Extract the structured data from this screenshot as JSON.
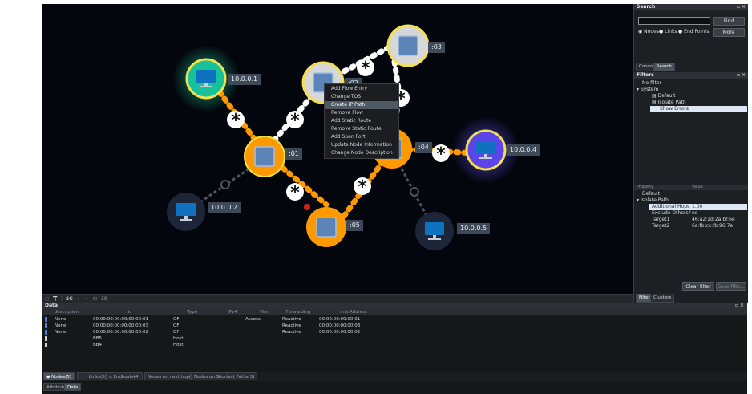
{
  "topology": {
    "nodes": [
      {
        "id": "host-1",
        "label": "10.0.0.1",
        "kind": "host",
        "status": "highlighted"
      },
      {
        "id": "host-2",
        "label": "10.0.0.2",
        "kind": "host"
      },
      {
        "id": "host-4",
        "label": "10.0.0.4",
        "kind": "host",
        "status": "selected"
      },
      {
        "id": "host-5",
        "label": "10.0.0.5",
        "kind": "host"
      },
      {
        "id": "sw-01",
        "label": ":01",
        "kind": "switch"
      },
      {
        "id": "sw-02",
        "label": ":02",
        "kind": "switch"
      },
      {
        "id": "sw-03",
        "label": ":03",
        "kind": "switch"
      },
      {
        "id": "sw-04",
        "label": ":04",
        "kind": "switch"
      },
      {
        "id": "sw-05",
        "label": ":05",
        "kind": "switch"
      }
    ],
    "context_menu": [
      "Add Flow Entry",
      "Change TOS",
      "Create IP Path",
      "Remove Flow",
      "Add Static Route",
      "Remove Static Route",
      "Add Span Port",
      "Update Node Information",
      "Change Node Description"
    ],
    "context_menu_selected": "Create IP Path"
  },
  "toolbar": {
    "t_label": "T",
    "sc_label": "SC",
    "zoom_text": "30"
  },
  "search": {
    "title": "Search",
    "input_value": "",
    "find_label": "Find",
    "options": [
      "Nodes",
      "Links",
      "End Points"
    ],
    "more_label": "More",
    "tabs": [
      "Console",
      "Search"
    ]
  },
  "filters": {
    "title": "Filters",
    "tree": [
      {
        "label": "No filter",
        "level": 0
      },
      {
        "label": "System",
        "level": 0,
        "expanded": true
      },
      {
        "label": "Default",
        "level": 1
      },
      {
        "label": "Isolate Path",
        "level": 1
      },
      {
        "label": "Show Errors",
        "level": 1,
        "selected": true
      }
    ],
    "prop_headers": [
      "Property",
      "Value"
    ],
    "props": [
      {
        "label": "Default",
        "value": "",
        "level": 0
      },
      {
        "label": "Isolate Path",
        "value": "",
        "level": 0,
        "expanded": true
      },
      {
        "label": "Additional Hops",
        "value": "1.00",
        "level": 1,
        "selected": true
      },
      {
        "label": "Exclude Others?",
        "value": "no",
        "level": 1
      },
      {
        "label": "Target1",
        "value": "46:a2:1d:2a:bf:6e",
        "level": 1
      },
      {
        "label": "Target2",
        "value": "6a:fb:cc:fb:96:7e",
        "level": 1
      }
    ],
    "clear_label": "Clear filter",
    "save_label": "Save filte...",
    "tabs": [
      "Filters",
      "Clusters"
    ]
  },
  "data_panel": {
    "title": "Data",
    "columns": [
      "description",
      "id",
      "Type",
      "IPv4",
      "Vlan",
      "Forwarding",
      "macAddress"
    ],
    "rows": [
      {
        "description": "None",
        "id": "00:00:00:00:00:00:00:01",
        "type": "OF",
        "ipv4": "",
        "vlan": "Access",
        "forwarding": "Reactive",
        "mac": "00:00:00:00:00:01"
      },
      {
        "description": "None",
        "id": "00:00:00:00:00:00:00:03",
        "type": "OF",
        "ipv4": "",
        "vlan": "",
        "forwarding": "Reactive",
        "mac": "00:00:00:00:00:03"
      },
      {
        "description": "None",
        "id": "00:00:00:00:00:00:00:02",
        "type": "OF",
        "ipv4": "",
        "vlan": "",
        "forwarding": "Reactive",
        "mac": "00:00:00:00:00:02"
      },
      {
        "description": "",
        "id": "BB5",
        "type": "Host",
        "ipv4": "",
        "vlan": "",
        "forwarding": "",
        "mac": ""
      },
      {
        "description": "",
        "id": "BB4",
        "type": "Host",
        "ipv4": "",
        "vlan": "",
        "forwarding": "",
        "mac": ""
      }
    ],
    "bottom_tabs": [
      "Nodes(5)",
      "Links(0)",
      "Endhosts(4)",
      "Nodes on next hop(10)",
      "Nodes on Shortest Paths(3)"
    ],
    "view_tabs": [
      "Attributes",
      "Data"
    ]
  },
  "colors": {
    "link": "#ff9900",
    "highlight_ring": "#f4e04b",
    "selected_glow": "#5e4ff0",
    "host_glow": "#1ec79a"
  }
}
